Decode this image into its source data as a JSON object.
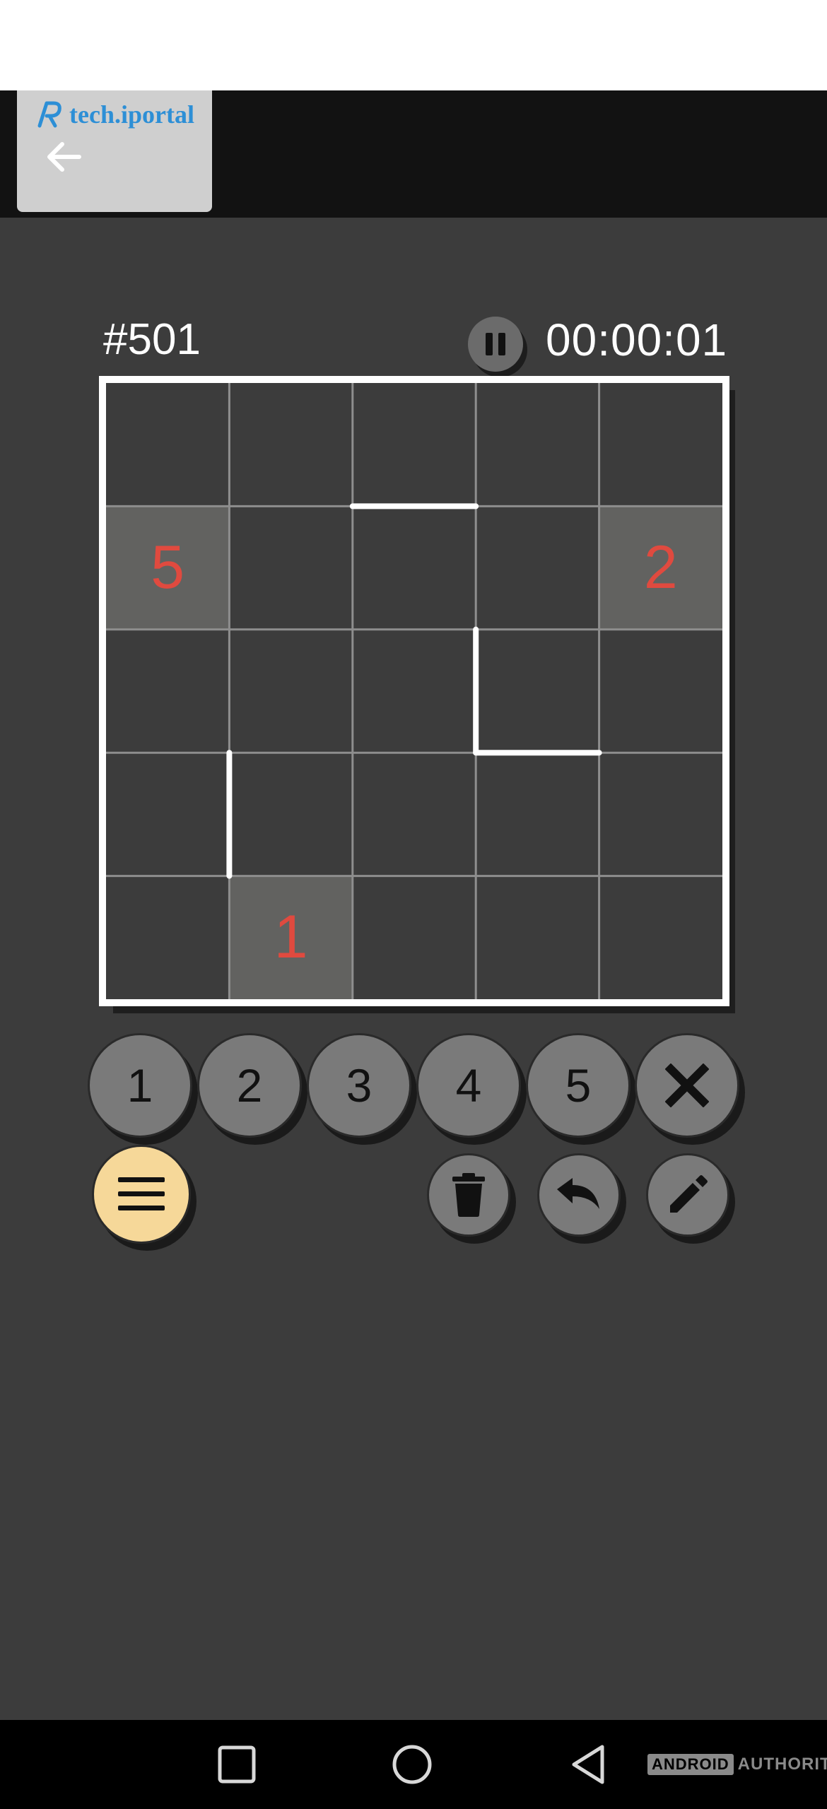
{
  "watermark_top": {
    "text": "tech.iportal"
  },
  "header": {
    "puzzle_id": "#501",
    "timer": "00:00:01"
  },
  "board": {
    "size": 5,
    "given_cells": [
      {
        "row": 1,
        "col": 0,
        "value": "5"
      },
      {
        "row": 1,
        "col": 4,
        "value": "2"
      },
      {
        "row": 4,
        "col": 1,
        "value": "1"
      }
    ],
    "walls": [
      {
        "orientation": "h",
        "row": 1,
        "col": 2
      },
      {
        "orientation": "v",
        "row": 2,
        "col": 3
      },
      {
        "orientation": "h",
        "row": 3,
        "col": 3
      },
      {
        "orientation": "v",
        "row": 3,
        "col": 1
      }
    ]
  },
  "keypad": {
    "numbers": [
      "1",
      "2",
      "3",
      "4",
      "5"
    ]
  },
  "watermark_bottom": {
    "boxed": "ANDROID",
    "plain": "AUTHORITY"
  },
  "colors": {
    "background": "#3c3c3c",
    "given_cell": "#626260",
    "clue_text": "#e04a3f",
    "menu_button": "#f6d899",
    "key_button": "#7a7a7a"
  }
}
